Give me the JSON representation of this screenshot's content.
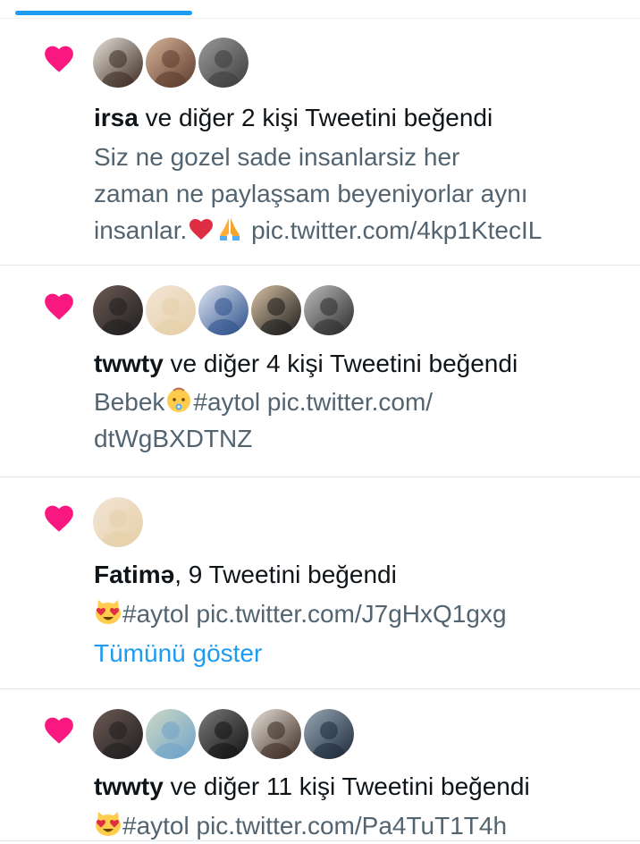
{
  "notifications": [
    {
      "user": "irsa",
      "action": " ve diğer 2 kişi Tweetini beğendi",
      "avatars": [
        {
          "name": "avatar-ny-cap",
          "colors": [
            "#3a2a20",
            "#e9e2da"
          ]
        },
        {
          "name": "avatar-woman-brown-hair",
          "colors": [
            "#5b3b2c",
            "#d9b49a"
          ]
        },
        {
          "name": "avatar-grey-silhouette",
          "colors": [
            "#3d3d3d",
            "#9a9a9a"
          ]
        }
      ],
      "text_lines": [
        "Siz ne gozel sade insanlarsiz her",
        "zaman ne paylaşsam beyeniyorlar aynı"
      ],
      "last_line_prefix": "insanlar.",
      "last_line_emojis": [
        "red-heart-emoji",
        "folded-hands-emoji"
      ],
      "last_line_suffix": " pic.twitter.com/4kp1KtecIL"
    },
    {
      "user": "twwty",
      "action": " ve diğer 4 kişi Tweetini beğendi",
      "avatars": [
        {
          "name": "avatar-dark-photo",
          "colors": [
            "#1f1f1f",
            "#6e5a55"
          ]
        },
        {
          "name": "avatar-blonde-woman",
          "colors": [
            "#e6cfa8",
            "#f3e6d6"
          ]
        },
        {
          "name": "avatar-blue-scarf",
          "colors": [
            "#2b4f8a",
            "#dfe6f2"
          ]
        },
        {
          "name": "avatar-blonde-dark-top",
          "colors": [
            "#1a1a1a",
            "#d9c2a5"
          ]
        },
        {
          "name": "avatar-bw-couple",
          "colors": [
            "#2b2b2b",
            "#bdbdbd"
          ]
        }
      ],
      "text_prefix": "Bebek",
      "text_emoji": "baby-emoji",
      "text_suffix": "#aytol pic.twitter.com/",
      "text_line2": "dtWgBXDTNZ"
    },
    {
      "user": "Fatimə",
      "action": ", 9 Tweetini beğendi",
      "avatars": [
        {
          "name": "avatar-blonde-woman",
          "colors": [
            "#e6cfa8",
            "#f3e6d6"
          ]
        }
      ],
      "text_emoji": "heart-eyes-cat-emoji",
      "text_suffix": "#aytol pic.twitter.com/J7gHxQ1gxg",
      "show_more": "Tümünü göster"
    },
    {
      "user": "twwty",
      "action": " ve diğer 11 kişi Tweetini beğendi",
      "avatars": [
        {
          "name": "avatar-dark-photo",
          "colors": [
            "#1f1f1f",
            "#6e5a55"
          ]
        },
        {
          "name": "avatar-coast-landscape",
          "colors": [
            "#6fa3c9",
            "#cfd9c4"
          ]
        },
        {
          "name": "avatar-man-dark-coat",
          "colors": [
            "#121212",
            "#7a7a7a"
          ]
        },
        {
          "name": "avatar-ny-cap",
          "colors": [
            "#3a2a20",
            "#e9e2da"
          ]
        },
        {
          "name": "avatar-car-night",
          "colors": [
            "#1d2a3a",
            "#9aa7b5"
          ]
        }
      ],
      "text_emoji": "heart-eyes-cat-emoji",
      "text_suffix": "#aytol pic.twitter.com/Pa4TuT1T4h"
    }
  ],
  "colors": {
    "like_heart": "#f91880",
    "link_blue": "#1d9bf0",
    "secondary_text": "#536471",
    "primary_text": "#0f1419",
    "divider": "#e1e8ed"
  }
}
